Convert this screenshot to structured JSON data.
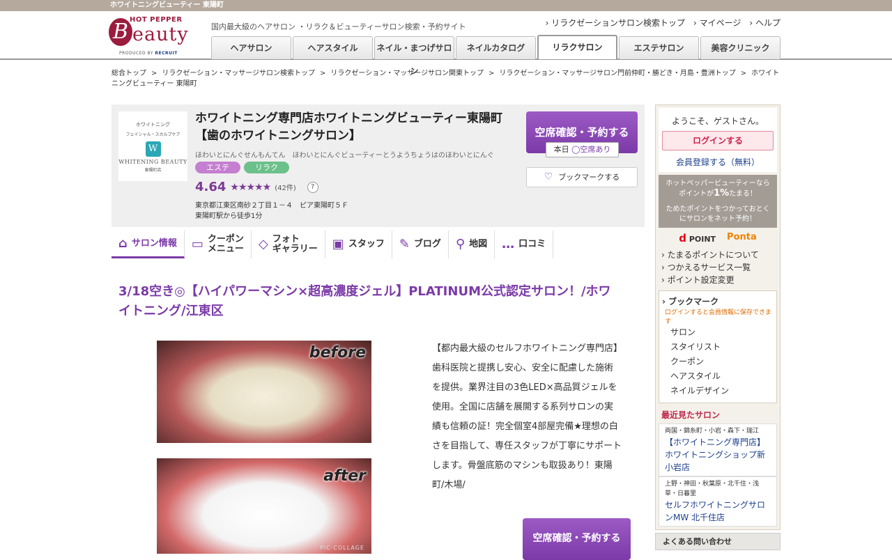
{
  "topbar": "ホワイトニングビューティー 東陽町",
  "logo": {
    "hotpepper": "HOT PEPPER",
    "b": "B",
    "eauty": "eauty",
    "produced": "PRODUCED BY",
    "recruit": "RECRUIT"
  },
  "tagline": "国内最大級のヘアサロン ・リラク＆ビューティーサロン検索・予約サイト",
  "toplinks": [
    "リラクゼーションサロン検索トップ",
    "マイページ",
    "ヘルプ"
  ],
  "gnav": [
    "ヘアサロン",
    "ヘアスタイル",
    "ネイル・まつげサロン",
    "ネイルカタログ",
    "リラクサロン",
    "エステサロン",
    "美容クリニック"
  ],
  "breadcrumb": [
    "総合トップ",
    "リラクゼーション・マッサージサロン検索トップ",
    "リラクゼーション・マッサージサロン関東トップ",
    "リラクゼーション・マッサージサロン門前仲町・勝どき・月島・豊洲トップ",
    "ホワイトニングビューティー 東陽町"
  ],
  "salon": {
    "logo": {
      "l1": "ホワイトニング",
      "l2": "フェイシャル・スカルプケア",
      "mark": "W",
      "l3": "WHITENING BEAUTY",
      "l4": "東陽町店"
    },
    "name": "ホワイトニング専門店ホワイトニングビューティー東陽町【歯のホワイトニングサロン】",
    "kana": "ほわいとにんぐせんもんてん　ほわいとにんぐビューティーとうようちょうはのほわいとにんぐ",
    "tags": [
      {
        "label": "エステ",
        "color": "#c57fd0"
      },
      {
        "label": "リラク",
        "color": "#6cc08a"
      }
    ],
    "rating": "4.64",
    "stars": "★★★★★",
    "review_count": "(42件)",
    "address": "東京都江東区南砂２丁目１－４　ピア東陽町５Ｆ",
    "access": "東陽町駅から徒歩1分",
    "reserve_label": "空席確認・予約する",
    "today": "本日",
    "avail": "◯空席あり",
    "bookmark_label": "ブックマークする"
  },
  "subnav": [
    {
      "icon": "⌂",
      "label": "サロン情報"
    },
    {
      "icon": "▭",
      "label": "クーポン\nメニュー"
    },
    {
      "icon": "◇",
      "label": "フォト\nギャラリー"
    },
    {
      "icon": "▣",
      "label": "スタッフ"
    },
    {
      "icon": "✎",
      "label": "ブログ"
    },
    {
      "icon": "⚲",
      "label": "地図"
    },
    {
      "icon": "…",
      "label": "口コミ"
    }
  ],
  "catch": "3/18空き◎【ハイパワーマシン×超高濃度ジェル】PLATINUM公式認定サロン！/ホワイトニング/江東区",
  "photo": {
    "before": "before",
    "after": "after",
    "credit": "PIC·COLLAGE"
  },
  "description": "【都内最大級のセルフホワイトニング専門店】歯科医院と提携し安心、安全に配慮した施術を提供。業界注目の3色LED×高品質ジェルを使用。全国に店舗を展開する系列サロンの実績も信頼の証！完全個室4部屋完備★理想の白さを目指して、専任スタッフが丁寧にサポートします。骨盤底筋のマシンも取扱あり！東陽町/木場/",
  "reserve2": "空席確認・予約する",
  "sidebar": {
    "welcome": "ようこそ、ゲストさん。",
    "login": "ログインする",
    "register": "会員登録する（無料）",
    "point1": "ホットペッパービューティーなら",
    "point2": "ポイントが",
    "point_pct": "1%",
    "point3": "たまる！",
    "point4": "ためたポイントをつかっておとく",
    "point5": "にサロンをネット予約！",
    "dpoint": "POINT",
    "d": "d",
    "ponta": "Ponta",
    "links": [
      "たまるポイントについて",
      "つかえるサービス一覧",
      "ポイント設定変更"
    ],
    "bm_title": "ブックマーク",
    "bm_note": "ログインすると会員情報に保存できます",
    "bm_items": [
      "サロン",
      "スタイリスト",
      "クーポン",
      "ヘアスタイル",
      "ネイルデザイン"
    ],
    "recent_title": "最近見たサロン",
    "recent": [
      {
        "area": "両国・錦糸町・小岩・森下・瑞江",
        "name": "【ホワイトニング専門店】ホワイトニングショップ新小岩店"
      },
      {
        "area": "上野・神田・秋葉原・北千住・浅草・日暮里",
        "name": "セルフホワイトニングサロンMW 北千住店"
      }
    ],
    "faq": "よくある問い合わせ"
  }
}
